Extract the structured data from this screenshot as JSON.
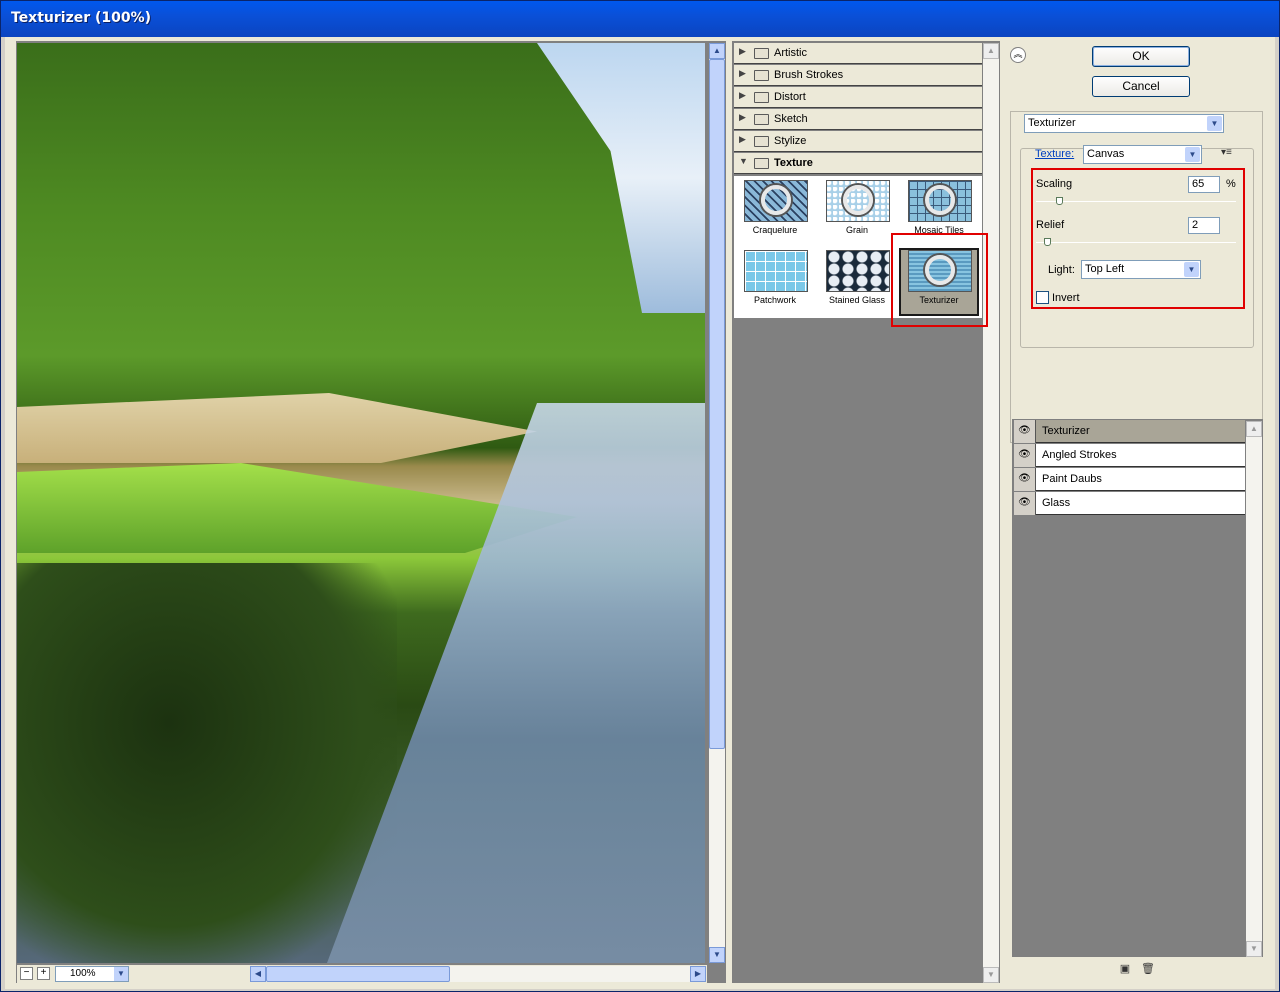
{
  "window": {
    "title": "Texturizer (100%)"
  },
  "preview": {
    "zoom": "100%",
    "zoom_out_label": "−",
    "zoom_in_label": "+"
  },
  "gallery": {
    "categories": [
      {
        "label": "Artistic",
        "expanded": false
      },
      {
        "label": "Brush Strokes",
        "expanded": false
      },
      {
        "label": "Distort",
        "expanded": false
      },
      {
        "label": "Sketch",
        "expanded": false
      },
      {
        "label": "Stylize",
        "expanded": false
      },
      {
        "label": "Texture",
        "expanded": true
      }
    ],
    "filters": [
      {
        "label": "Craquelure"
      },
      {
        "label": "Grain"
      },
      {
        "label": "Mosaic Tiles"
      },
      {
        "label": "Patchwork"
      },
      {
        "label": "Stained Glass"
      },
      {
        "label": "Texturizer",
        "selected": true
      }
    ]
  },
  "buttons": {
    "ok": "OK",
    "cancel": "Cancel"
  },
  "settings": {
    "filter_select": "Texturizer",
    "texture_label": "Texture:",
    "texture_value": "Canvas",
    "scaling_label": "Scaling",
    "scaling_value": "65",
    "scaling_unit": "%",
    "scaling_fraction": 0.1,
    "relief_label": "Relief",
    "relief_value": "2",
    "relief_fraction": 0.04,
    "light_label": "Light:",
    "light_value": "Top Left",
    "invert_label": "Invert",
    "invert_checked": false
  },
  "layers": [
    {
      "name": "Texturizer",
      "selected": true,
      "visible": true
    },
    {
      "name": "Angled Strokes",
      "selected": false,
      "visible": true
    },
    {
      "name": "Paint Daubs",
      "selected": false,
      "visible": true
    },
    {
      "name": "Glass",
      "selected": false,
      "visible": true
    }
  ],
  "icons": {
    "collapse": "double-chevron-up-icon",
    "eye": "eye-icon",
    "new_layer": "new-layer-icon",
    "delete_layer": "trash-icon",
    "folder": "folder-icon"
  },
  "colors": {
    "titlebar": "#0058ee",
    "highlight": "#e00000",
    "selected": "#a9a597"
  }
}
